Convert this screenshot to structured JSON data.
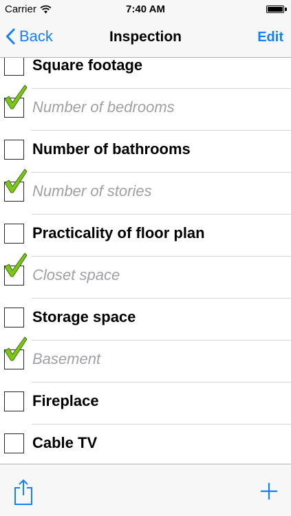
{
  "status_bar": {
    "carrier": "Carrier",
    "time": "7:40 AM",
    "wifi_icon": "wifi-icon",
    "battery_icon": "battery-icon",
    "battery_level": 1.0
  },
  "nav": {
    "back_label": "Back",
    "title": "Inspection",
    "edit_label": "Edit",
    "accent_color": "#147efb"
  },
  "items": [
    {
      "label": "Square footage",
      "checked": false
    },
    {
      "label": "Number of bedrooms",
      "checked": true
    },
    {
      "label": "Number of bathrooms",
      "checked": false
    },
    {
      "label": "Number of stories",
      "checked": true
    },
    {
      "label": "Practicality of floor plan",
      "checked": false
    },
    {
      "label": "Closet space",
      "checked": true
    },
    {
      "label": "Storage space",
      "checked": false
    },
    {
      "label": "Basement",
      "checked": true
    },
    {
      "label": "Fireplace",
      "checked": false
    },
    {
      "label": "Cable TV",
      "checked": false
    }
  ],
  "toolbar": {
    "share_icon": "share-icon",
    "add_icon": "plus-icon"
  },
  "colors": {
    "checked_text": "#a0a0a4",
    "checkmark_green": "#7cc61a"
  }
}
